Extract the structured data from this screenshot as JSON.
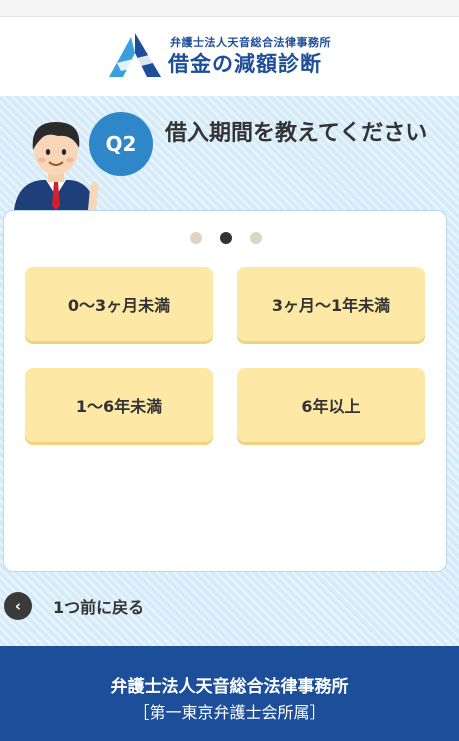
{
  "header": {
    "firm_name": "弁護士法人天音総合法律事務所",
    "service_title": "借金の減額診断"
  },
  "question": {
    "badge": "Q2",
    "text": "借入期間を教えてください"
  },
  "progress": {
    "steps": 3,
    "current": 2
  },
  "options": [
    {
      "label": "0〜3ヶ月未満"
    },
    {
      "label": "3ヶ月〜1年未満"
    },
    {
      "label": "1〜6年未満"
    },
    {
      "label": "6年以上"
    }
  ],
  "back_button": {
    "label": "1つ前に戻る"
  },
  "footer": {
    "firm_name": "弁護士法人天音総合法律事務所",
    "affiliation": "［第一東京弁護士会所属］"
  },
  "colors": {
    "brand_blue": "#1d4e9a",
    "badge_blue": "#2e87c9",
    "option_yellow": "#fde9a5",
    "panel_blue": "#d6ebfa"
  }
}
